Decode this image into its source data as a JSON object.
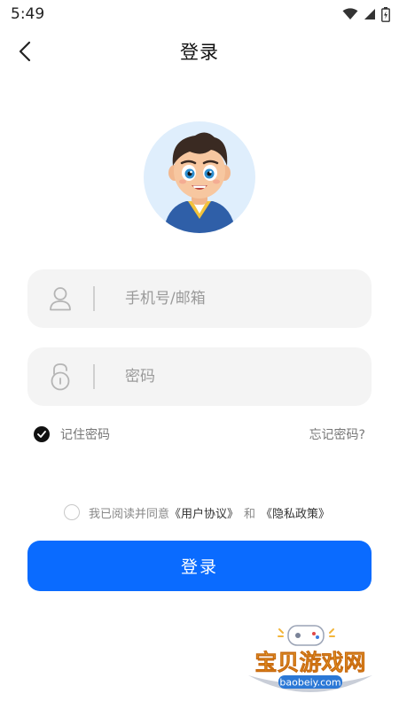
{
  "status_bar": {
    "time": "5:49",
    "icons": [
      "wifi-icon",
      "signal-icon",
      "battery-icon"
    ]
  },
  "header": {
    "title": "登录",
    "back_icon": "chevron-left-icon"
  },
  "form": {
    "phone_placeholder": "手机号/邮箱",
    "password_placeholder": "密码",
    "remember_label": "记住密码",
    "remember_checked": true,
    "forgot_label": "忘记密码?"
  },
  "agreement": {
    "checked": false,
    "prefix": "我已阅读并同意",
    "user_agreement": "《用户协议》",
    "and": "和",
    "privacy_policy": "《隐私政策》"
  },
  "login_button": {
    "label": "登录"
  },
  "watermark": {
    "brand": "宝贝游戏网",
    "url": "baobeiy.com"
  },
  "colors": {
    "primary": "#0a6bff",
    "field_bg": "#f4f4f4",
    "avatar_bg": "#dfeefc"
  }
}
